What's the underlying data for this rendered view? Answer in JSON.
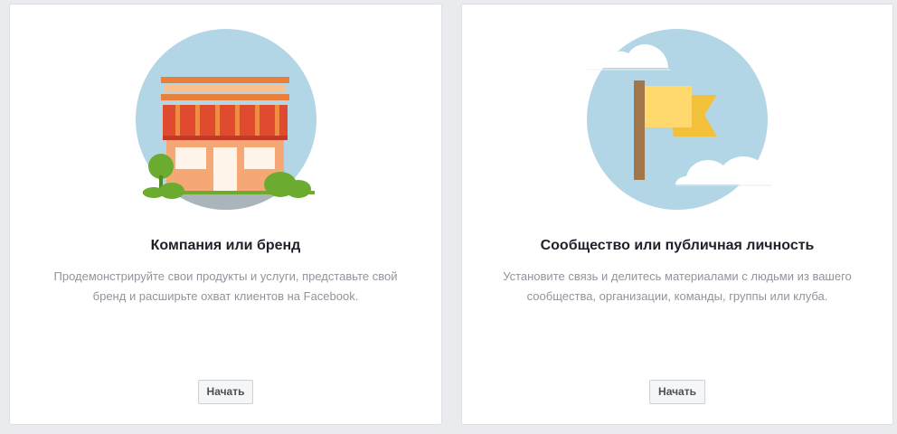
{
  "cards": [
    {
      "title": "Компания или бренд",
      "description_lines": [
        "Продемонстрируйте свои продукты и услуги, представьте свой",
        "бренд и расширьте охват клиентов на Facebook."
      ],
      "button_label": "Начать",
      "illustration": "storefront-icon"
    },
    {
      "title": "Сообщество или публичная личность",
      "description_lines": [
        "Установите связь и делитесь материалами с людьми из вашего",
        "сообщества, организации, команды, группы или клуба."
      ],
      "button_label": "Начать",
      "illustration": "flag-icon"
    }
  ],
  "colors": {
    "page_background": "#e9ebee",
    "card_background": "#ffffff",
    "circle": "#b3d6e6",
    "awning_red": "#e04a2f",
    "building_orange": "#f5a876",
    "tree_green": "#6aab30",
    "flag_yellow": "#ffd86e",
    "flag_gold": "#f3c03a",
    "pole_brown": "#a0764a",
    "title_text": "#1d2129",
    "description_text": "#90949c"
  }
}
